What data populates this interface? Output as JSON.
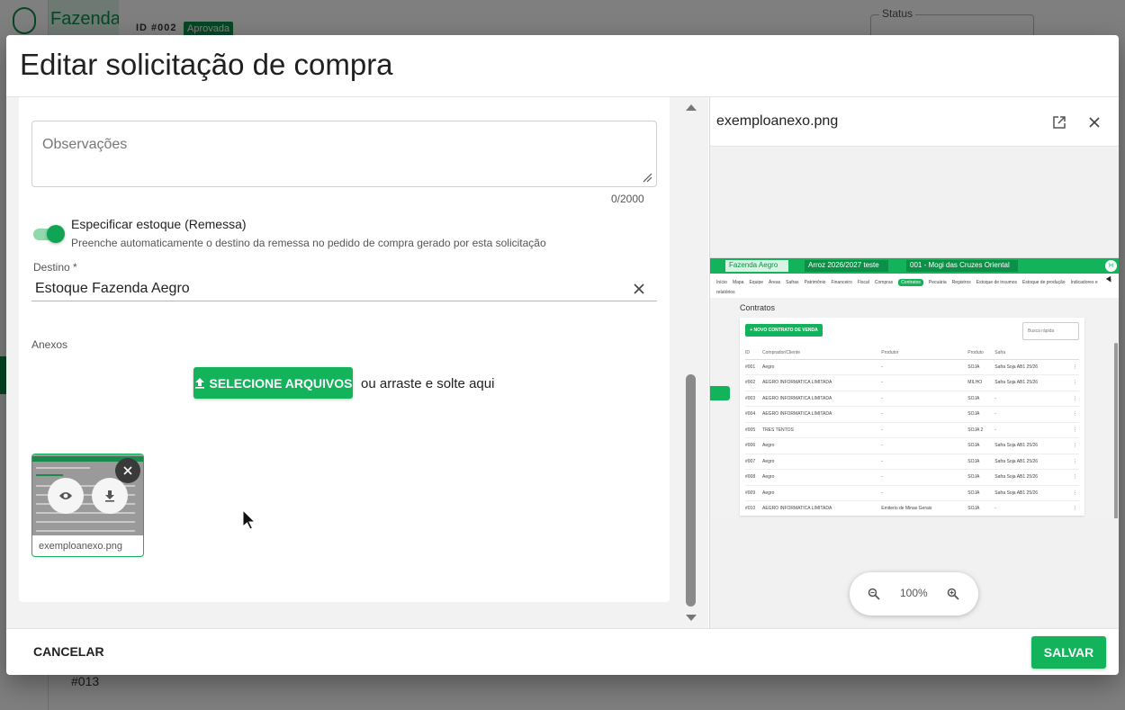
{
  "background": {
    "farm_name": "Fazenda",
    "request_id": "ID #002",
    "status_badge": "Aprovada",
    "status_label": "Status",
    "row_id": "#013"
  },
  "dialog": {
    "title": "Editar solicitação de compra"
  },
  "form": {
    "observations_placeholder": "Observações",
    "observations_counter": "0/2000",
    "toggle_title": "Especificar estoque (Remessa)",
    "toggle_subtitle": "Preenche automaticamente o destino da remessa no pedido de compra gerado por esta solicitação",
    "toggle_on": true,
    "destination_label": "Destino *",
    "destination_value": "Estoque Fazenda Aegro",
    "attachments_label": "Anexos",
    "upload_button": "SELECIONE ARQUIVOS",
    "drop_text": "ou arraste e solte aqui",
    "attachment_name": "exemploanexo.png"
  },
  "preview": {
    "file_name": "exemploanexo.png",
    "zoom_level": "100%",
    "screenshot": {
      "farm_select": "Fazenda Aegro",
      "season_select": "Arroz 2026/2027 teste",
      "field_select": "001 - Mogi das Cruzes Oriental",
      "avatar_initial": "H",
      "nav_items": [
        "Início",
        "Mapa",
        "Equipe",
        "Áreas",
        "Safras",
        "Patrimônio",
        "Financeiro",
        "Fiscal",
        "Compras",
        "Contratos",
        "Pecuária",
        "Registros",
        "Estoque de insumos",
        "Estoque de produção",
        "Indicadores e relatórios"
      ],
      "active_nav": "Contratos",
      "page_title": "Contratos",
      "new_button": "+ NOVO CONTRATO DE VENDA",
      "search_placeholder": "Busca rápida",
      "columns": [
        "ID",
        "Comprador/Cliente",
        "Produtor",
        "Produto",
        "Safra"
      ],
      "rows": [
        [
          "#001",
          "Aegro",
          "-",
          "SOJA",
          "Safra Soja AB1 25/26"
        ],
        [
          "#002",
          "AEGRO INFORMATICA LIMITADA",
          "-",
          "MILHO",
          "Safra Soja AB1 25/26"
        ],
        [
          "#003",
          "AEGRO INFORMATICA LIMITADA",
          "-",
          "SOJA",
          "-"
        ],
        [
          "#004",
          "AEGRO INFORMATICA LIMITADA",
          "-",
          "SOJA",
          "-"
        ],
        [
          "#005",
          "TRES TENTOS",
          "-",
          "SOJA 2",
          "-"
        ],
        [
          "#006",
          "Aegro",
          "-",
          "SOJA",
          "Safra Soja AB1 25/26"
        ],
        [
          "#007",
          "Aegro",
          "-",
          "SOJA",
          "Safra Soja AB1 25/26"
        ],
        [
          "#008",
          "Aegro",
          "-",
          "SOJA",
          "Safra Soja AB1 25/26"
        ],
        [
          "#009",
          "Aegro",
          "-",
          "SOJA",
          "Safra Soja AB1 25/26"
        ],
        [
          "#010",
          "AEGRO INFORMATICA LIMITADA",
          "Emiterio de Minas Gerais",
          "SOJA",
          "-"
        ]
      ]
    }
  },
  "footer": {
    "cancel_label": "CANCELAR",
    "save_label": "SALVAR"
  },
  "colors": {
    "brand_green": "#12b35b",
    "dark_green": "#0a8f4a"
  }
}
